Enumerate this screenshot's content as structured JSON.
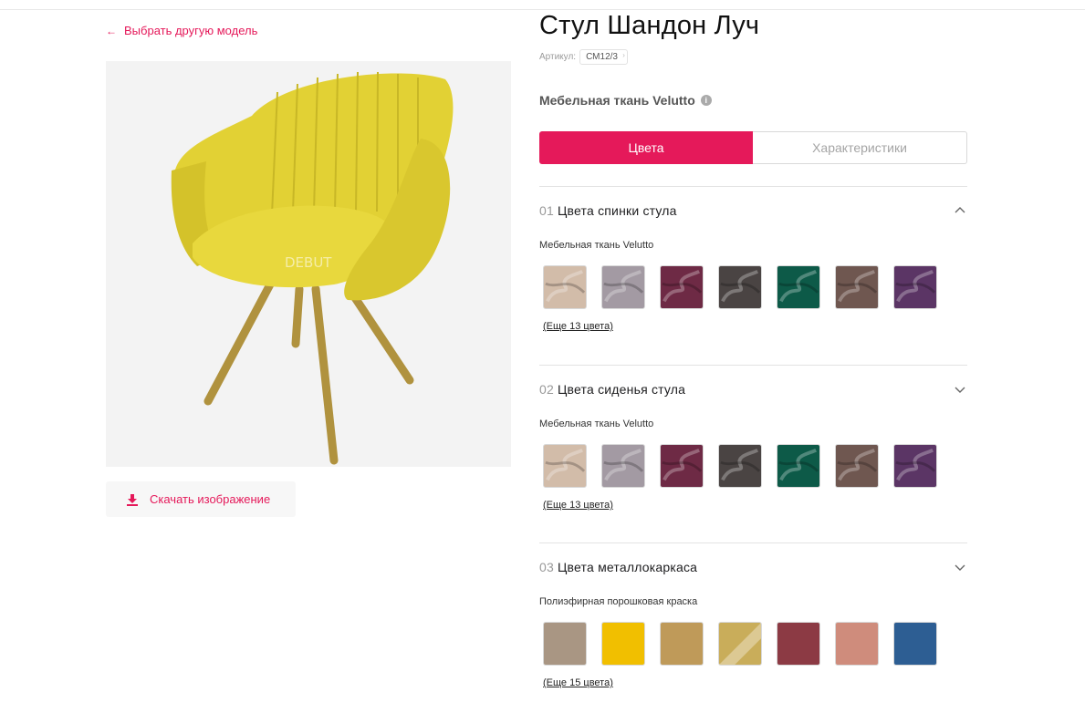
{
  "nav": {
    "back_label": "Выбрать другую модель"
  },
  "product": {
    "title": "Стул Шандон Луч",
    "sku_label": "Артикул:",
    "sku": "СМ12/3",
    "fabric": "Мебельная ткань Velutto",
    "watermark": "DEBUT"
  },
  "download_label": "Скачать изображение",
  "tabs": [
    {
      "label": "Цвета",
      "active": true
    },
    {
      "label": "Характеристики",
      "active": false
    }
  ],
  "sections": [
    {
      "num": "01",
      "title": "Цвета спинки стула",
      "expanded": true,
      "subtitle": "Мебельная ткань Velutto",
      "swatches": [
        "#d2bca9",
        "#a39aa3",
        "#6e2a45",
        "#4a4443",
        "#0d5a48",
        "#6f5750",
        "#5b3565"
      ],
      "more": "(Еще 13 цвета)"
    },
    {
      "num": "02",
      "title": "Цвета сиденья стула",
      "expanded": false,
      "subtitle": "Мебельная ткань Velutto",
      "swatches": [
        "#d2bca9",
        "#a39aa3",
        "#6e2a45",
        "#4a4443",
        "#0d5a48",
        "#6f5750",
        "#5b3565"
      ],
      "more": "(Еще 13 цвета)"
    },
    {
      "num": "03",
      "title": "Цвета металлокаркаса",
      "expanded": false,
      "subtitle": "Полиэфирная порошковая краска",
      "swatches": [
        "#a99683",
        "#f1bf00",
        "#bf9a59",
        "#c9ad5a",
        "#8c3a44",
        "#cf8c7c",
        "#2d5e93"
      ],
      "more": "(Еще 15 цвета)"
    }
  ],
  "colors": {
    "accent": "#e5195a",
    "chair_fabric": "#e1cf33",
    "chair_legs": "#b89b48"
  }
}
